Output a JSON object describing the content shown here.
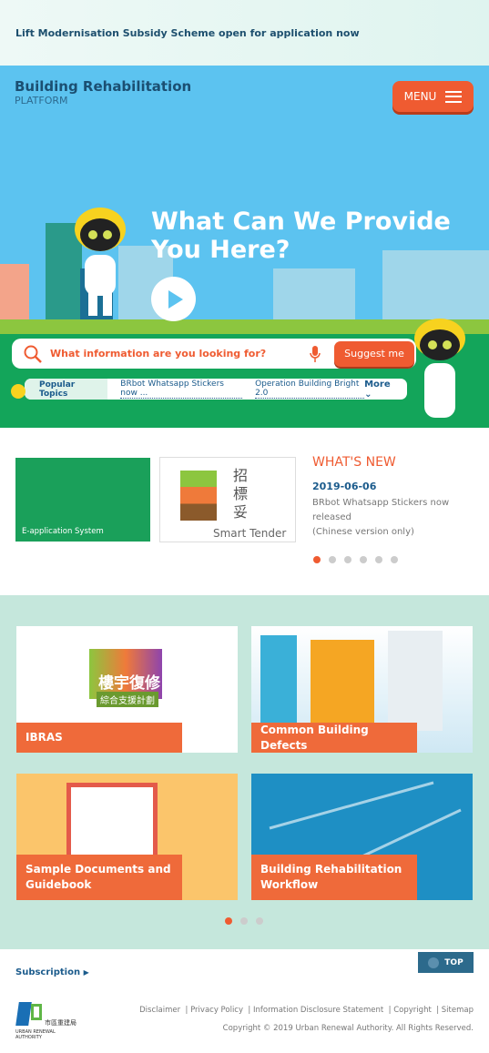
{
  "notice": {
    "text": "Lift Modernisation Subsidy Scheme open for application now"
  },
  "header": {
    "logo_line1": "Building Rehabilitation",
    "logo_line2": "PLATFORM",
    "menu_label": "MENU"
  },
  "hero": {
    "title_line1": "What Can We Provide",
    "title_line2": "You Here?"
  },
  "search": {
    "placeholder": "What information are you looking for?",
    "suggest_label": "Suggest me",
    "popular_label": "Popular Topics",
    "topics": [
      "BRbot Whatsapp Stickers now ...",
      "Operation Building Bright 2.0"
    ],
    "more_label": "More"
  },
  "news": {
    "card1_label": "E-application System",
    "card2_label": "Smart Tender",
    "card2_cjk": "招標妥",
    "heading": "WHAT'S NEW",
    "date": "2019-06-06",
    "text_line1": "BRbot Whatsapp Stickers now released",
    "text_line2": "(Chinese version only)",
    "slides": 6,
    "active_slide": 1
  },
  "tiles": {
    "items": [
      {
        "label": "IBRAS",
        "cjk": "樓宇復修",
        "cjk2": "綜合支援計劃"
      },
      {
        "label": "Common Building Defects"
      },
      {
        "label_line1": "Sample Documents and",
        "label_line2": "Guidebook"
      },
      {
        "label_line1": "Building Rehabilitation",
        "label_line2": "Workflow"
      }
    ],
    "pages": 3,
    "active_page": 1
  },
  "footer": {
    "subscription": "Subscription",
    "top_label": "TOP",
    "links": [
      "Disclaimer",
      "Privacy Policy",
      "Information Disclosure Statement",
      "Copyright",
      "Sitemap"
    ],
    "copyright": "Copyright © 2019 Urban Renewal Authority. All Rights Reserved.",
    "logo_text": "URBAN RENEWAL AUTHORITY",
    "logo_cjk": "市區重建局"
  },
  "colors": {
    "accent": "#ef5b31",
    "primary": "#1b5b8c",
    "hero": "#5cc3f0",
    "green": "#13a55a"
  }
}
